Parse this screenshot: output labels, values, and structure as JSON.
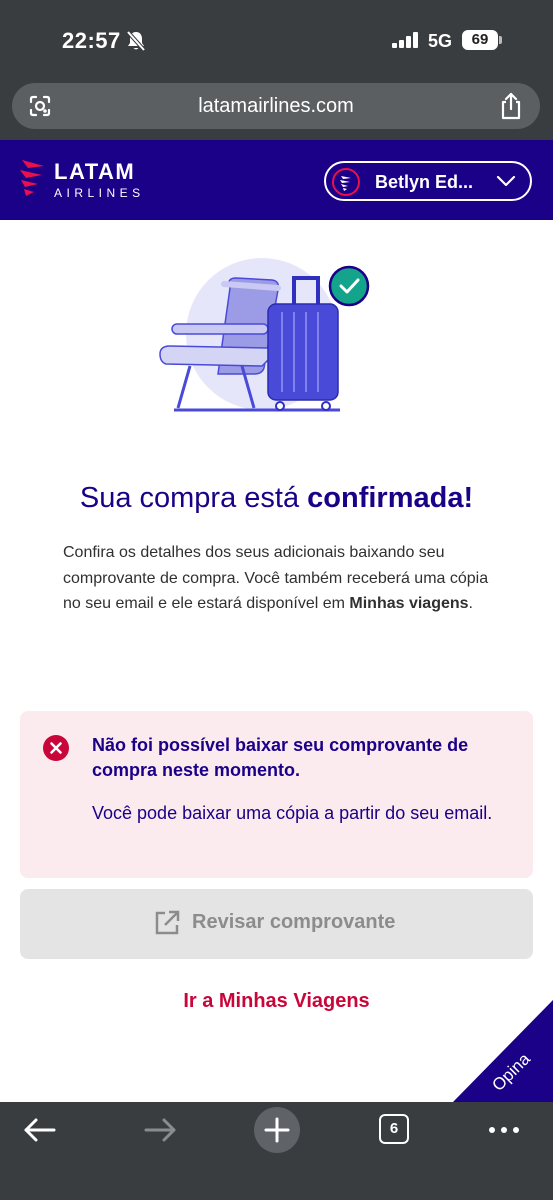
{
  "status_bar": {
    "time": "22:57",
    "network": "5G",
    "battery": "69"
  },
  "browser": {
    "url": "latamairlines.com",
    "tab_count": "6"
  },
  "header": {
    "logo_text": "LATAM",
    "logo_subtext": "AIRLINES",
    "user_name": "Betlyn Ed...",
    "brand_color": "#1b0088",
    "accent_color": "#e8114b"
  },
  "confirmation": {
    "title_prefix": "Sua compra está ",
    "title_emphasis": "confirmada!",
    "description": "Confira os detalhes dos seus adicionais baixando seu comprovante de compra. Você também receberá uma cópia no seu email e ele estará disponível em ",
    "description_emphasis": "Minhas viagens",
    "description_end": "."
  },
  "alert": {
    "title": "Não foi possível baixar seu comprovante de compra neste momento.",
    "body": "Você pode baixar uma cópia a partir do seu email.",
    "icon": "error-icon",
    "color": "#c8063a"
  },
  "actions": {
    "review_label": "Revisar comprovante",
    "trips_link": "Ir a Minhas Viagens"
  },
  "feedback": {
    "label": "Opina"
  }
}
